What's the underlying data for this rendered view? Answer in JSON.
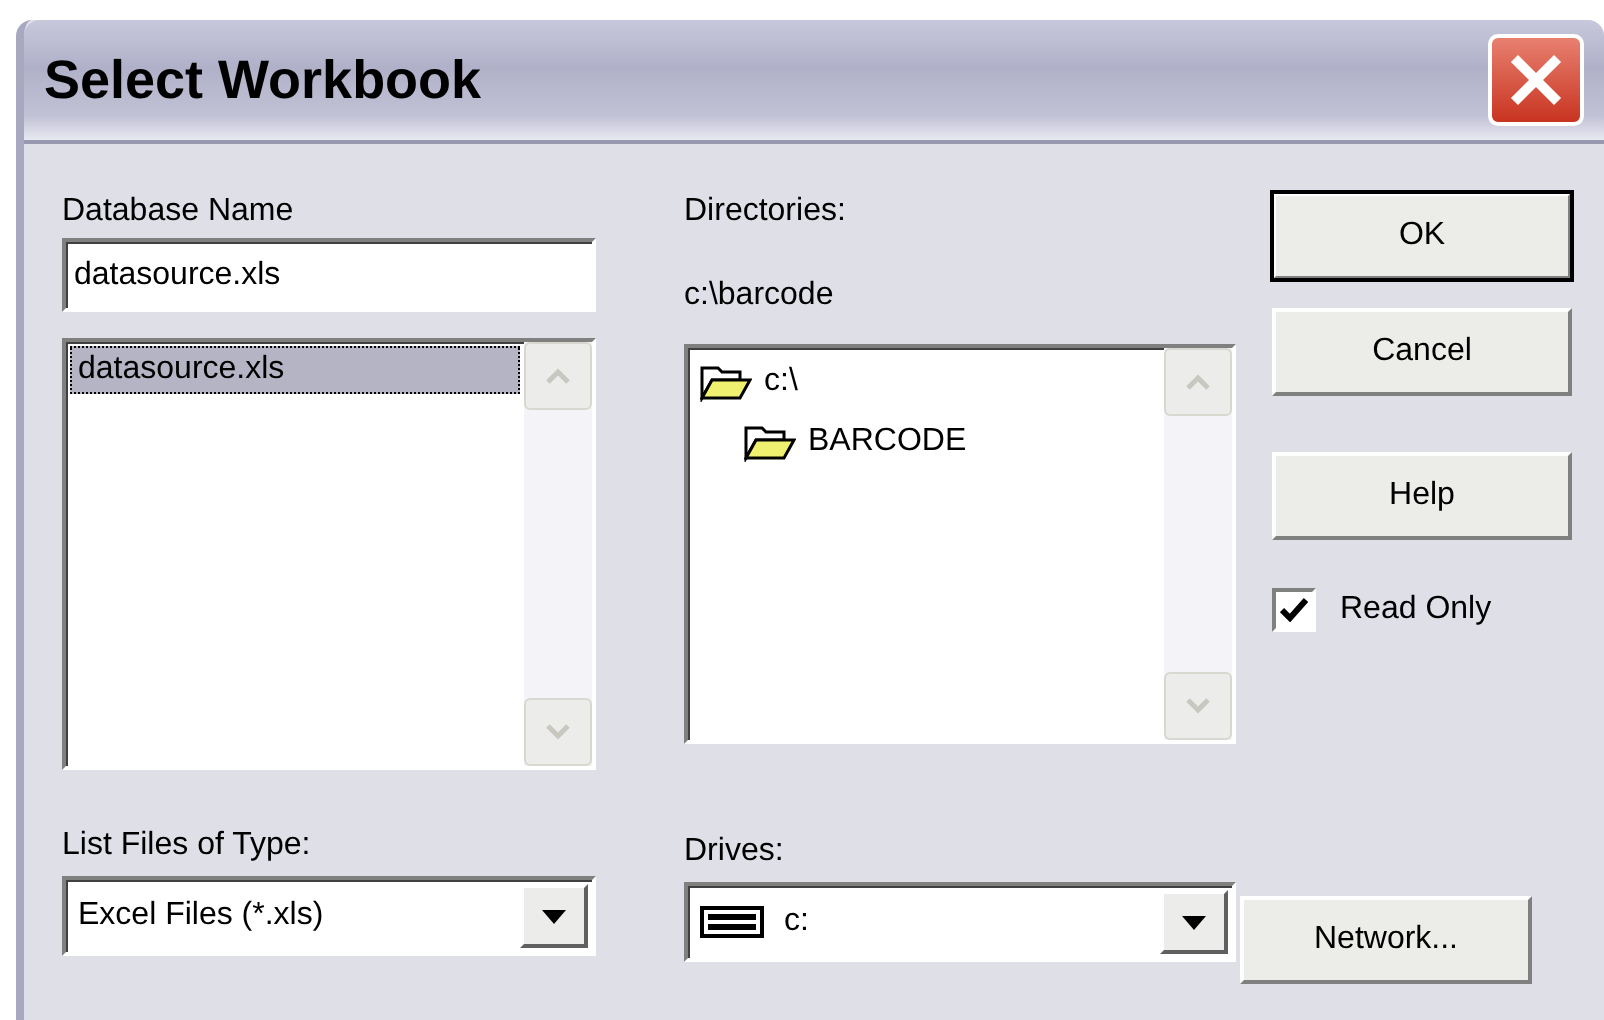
{
  "window": {
    "title": "Select Workbook"
  },
  "database_name": {
    "label": "Database Name",
    "value": "datasource.xls"
  },
  "files": [
    {
      "name": "datasource.xls",
      "selected": true
    }
  ],
  "directories": {
    "label": "Directories:",
    "current": "c:\\barcode",
    "items": [
      {
        "name": "c:\\",
        "kind": "open",
        "children": [
          {
            "name": "BARCODE",
            "kind": "open"
          }
        ]
      }
    ]
  },
  "buttons": [
    {
      "label": "OK",
      "default": true
    },
    {
      "label": "Cancel",
      "default": false
    },
    {
      "label": "Help",
      "default": false
    }
  ],
  "read_only": {
    "label": "Read Only",
    "checked": true
  },
  "file_type": {
    "label": "List Files of Type:",
    "value": "Excel Files (*.xls)"
  },
  "drives": {
    "label": "Drives:",
    "value": "c:"
  },
  "network_button": {
    "label": "Network..."
  }
}
